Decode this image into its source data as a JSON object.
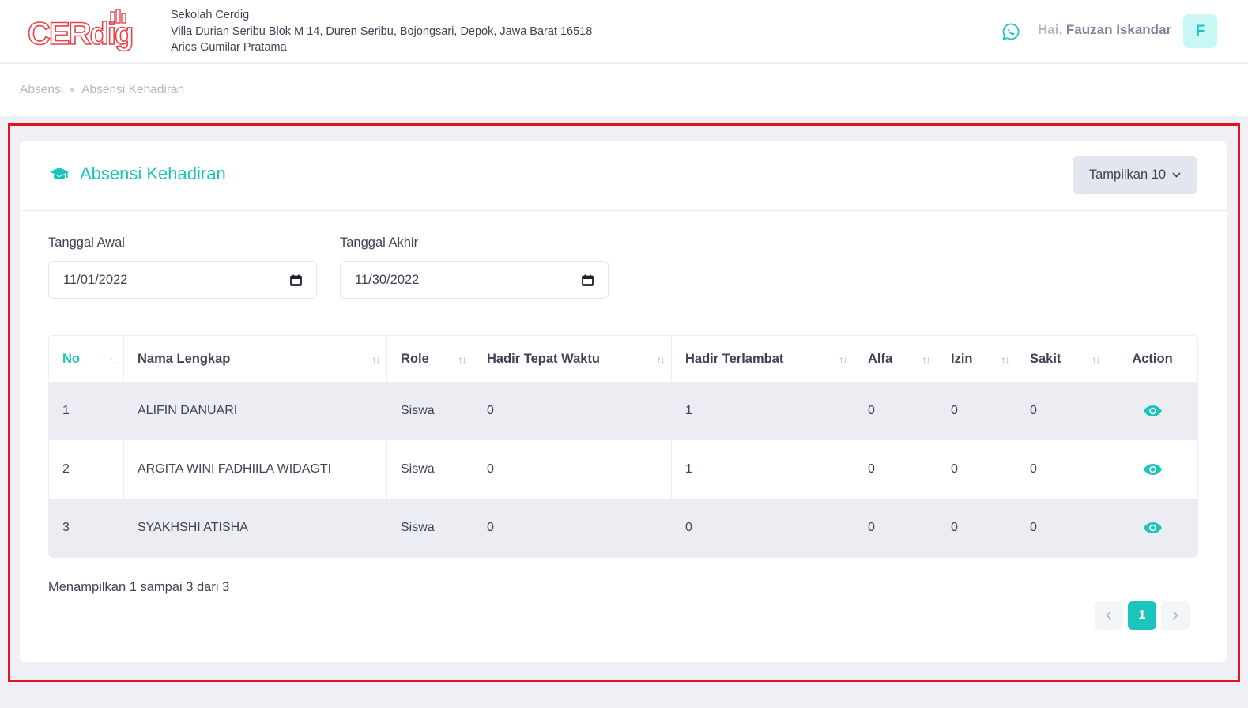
{
  "header": {
    "logo_text": "CERdig",
    "school_name": "Sekolah Cerdig",
    "school_address": "Villa Durian Seribu Blok M 14, Duren Seribu, Bojongsari, Depok, Jawa Barat 16518",
    "school_person": "Aries Gumilar Pratama",
    "whatsapp_icon": "whatsapp-icon",
    "greeting": "Hai,",
    "user_name": "Fauzan Iskandar",
    "avatar_initial": "F"
  },
  "breadcrumb": [
    "Absensi",
    "Absensi Kehadiran"
  ],
  "card": {
    "title": "Absensi Kehadiran",
    "title_icon": "graduation-cap-icon",
    "show_button": "Tampilkan 10"
  },
  "filters": {
    "start_label": "Tanggal Awal",
    "start_value": "11/01/2022",
    "end_label": "Tanggal Akhir",
    "end_value": "11/30/2022"
  },
  "table": {
    "columns": [
      "No",
      "Nama Lengkap",
      "Role",
      "Hadir Tepat Waktu",
      "Hadir Terlambat",
      "Alfa",
      "Izin",
      "Sakit",
      "Action"
    ],
    "rows": [
      [
        "1",
        "ALIFIN DANUARI",
        "Siswa",
        "0",
        "1",
        "0",
        "0",
        "0"
      ],
      [
        "2",
        "ARGITA WINI FADHIILA WIDAGTI",
        "Siswa",
        "0",
        "1",
        "0",
        "0",
        "0"
      ],
      [
        "3",
        "SYAKHSHI ATISHA",
        "Siswa",
        "0",
        "0",
        "0",
        "0",
        "0"
      ]
    ],
    "action_icon": "eye-icon"
  },
  "footer": {
    "info": "Menampilkan 1 sampai 3 dari 3",
    "current_page": "1"
  },
  "colors": {
    "accent": "#1bc5bd",
    "brand_red": "#e8434a",
    "highlight_border": "#e3121b"
  }
}
